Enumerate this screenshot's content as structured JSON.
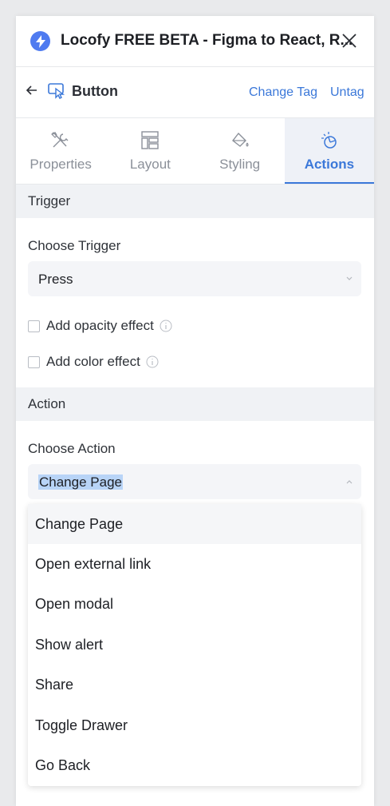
{
  "window": {
    "title": "Locofy FREE BETA - Figma to React, R..."
  },
  "header": {
    "title": "Button",
    "change_tag": "Change Tag",
    "untag": "Untag"
  },
  "tabs": [
    {
      "label": "Properties",
      "active": false
    },
    {
      "label": "Layout",
      "active": false
    },
    {
      "label": "Styling",
      "active": false
    },
    {
      "label": "Actions",
      "active": true
    }
  ],
  "trigger": {
    "section_title": "Trigger",
    "choose_label": "Choose Trigger",
    "selected": "Press",
    "opacity_effect": "Add opacity effect",
    "color_effect": "Add color effect"
  },
  "action": {
    "section_title": "Action",
    "choose_label": "Choose Action",
    "selected": "Change Page",
    "options": [
      "Change Page",
      "Open external link",
      "Open modal",
      "Show alert",
      "Share",
      "Toggle Drawer",
      "Go Back"
    ]
  },
  "colors": {
    "accent": "#3b78d9",
    "logo": "#4f7bf0",
    "section_bg": "#f0f2f5"
  }
}
